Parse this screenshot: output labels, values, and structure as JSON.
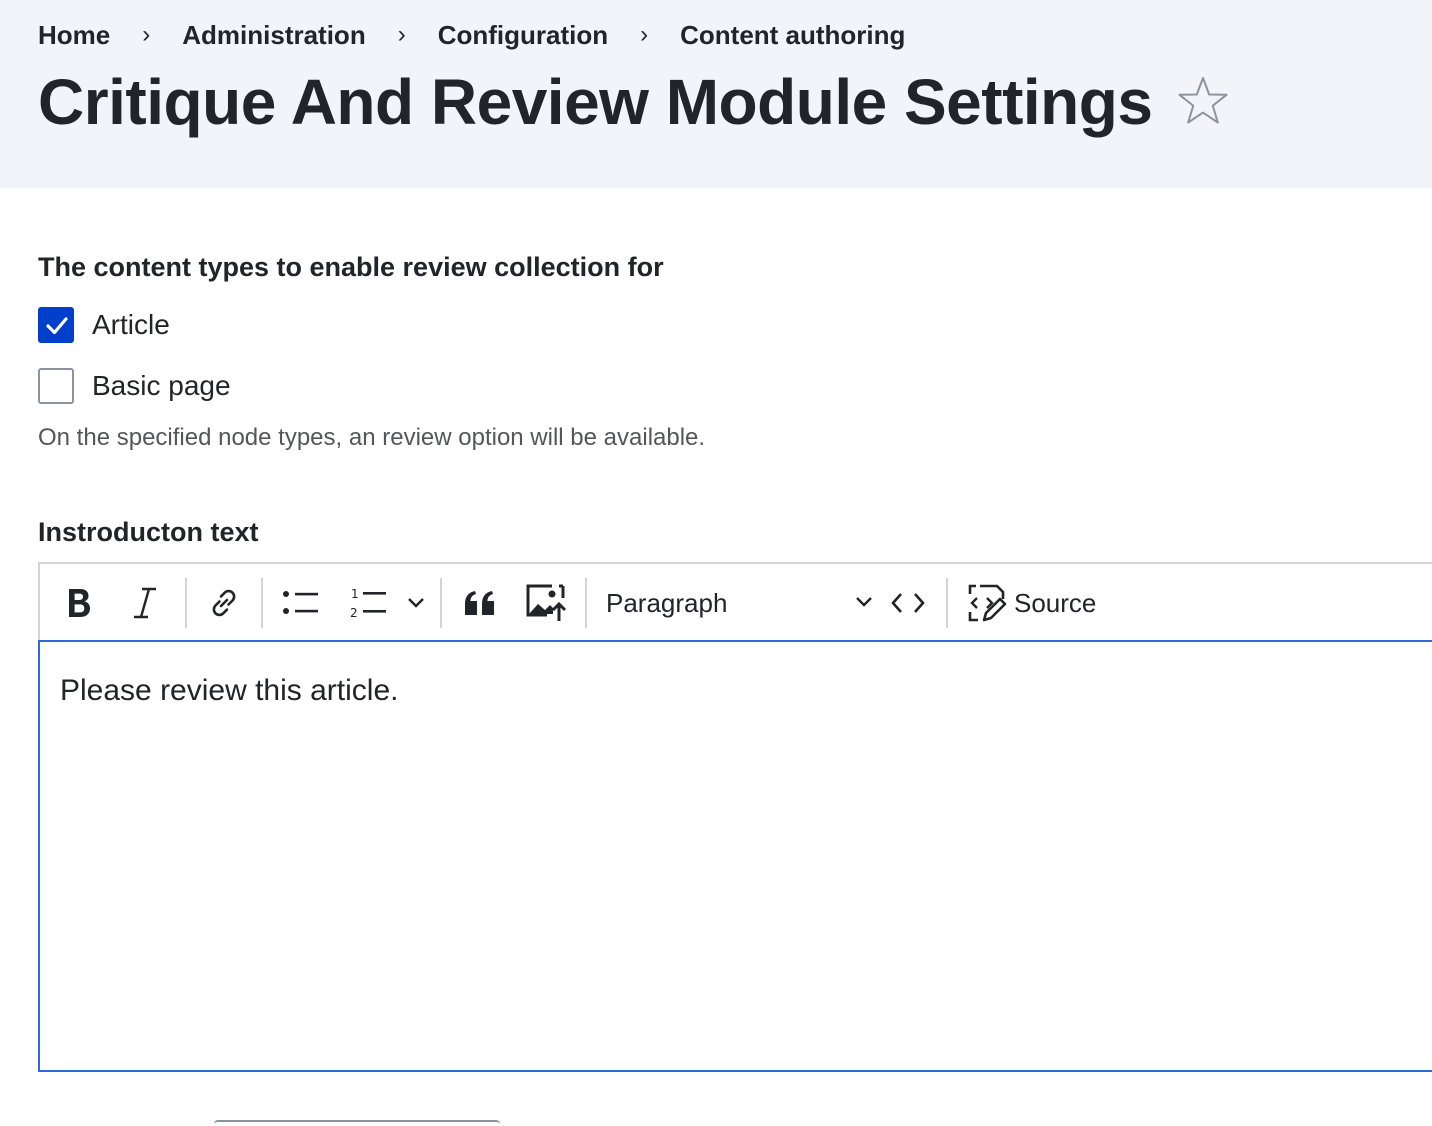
{
  "breadcrumb": {
    "items": [
      "Home",
      "Administration",
      "Configuration",
      "Content authoring"
    ],
    "separator": "›"
  },
  "page": {
    "title": "Critique And Review Module Settings"
  },
  "content_types": {
    "legend": "The content types to enable review collection for",
    "options": [
      {
        "label": "Article",
        "checked": true
      },
      {
        "label": "Basic page",
        "checked": false
      }
    ],
    "description": "On the specified node types, an review option will be available."
  },
  "intro": {
    "label": "Instroducton text",
    "toolbar": {
      "heading_value": "Paragraph",
      "source_label": "Source"
    },
    "content": "Please review this article."
  },
  "colors": {
    "accent": "#003ecc",
    "focus_border": "#2c6bd9",
    "header_bg": "#f3f4f9",
    "text": "#232429"
  }
}
